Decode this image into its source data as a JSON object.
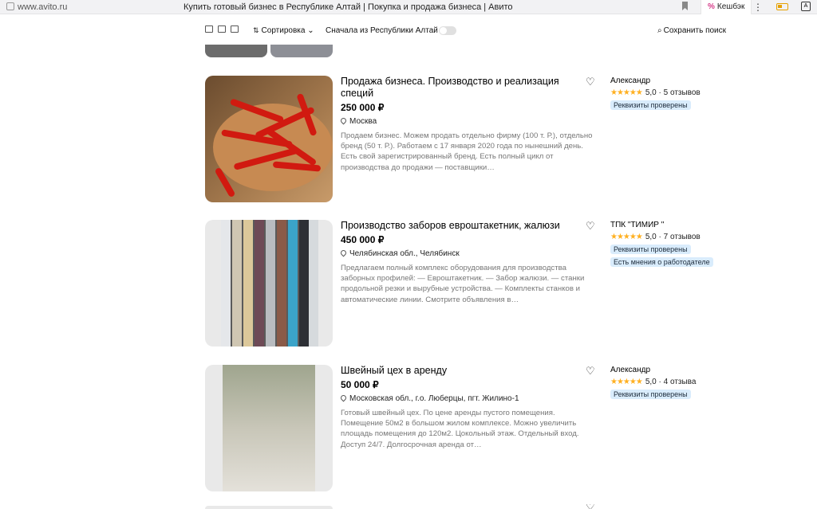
{
  "browser": {
    "url": "www.avito.ru",
    "title": "Купить готовый бизнес в Республике Алтай | Покупка и продажа бизнеса | Авито",
    "cashback": "Кешбэк",
    "cashback_icon": "%"
  },
  "toolbar": {
    "sort_label": "Сортировка",
    "region_filter": "Сначала из Республики Алтай",
    "region_filter_enabled": false,
    "save_search": "Сохранить поиск"
  },
  "listings": [
    {
      "title": "Продажа бизнеса. Производство и реализация специй",
      "price": "250 000 ₽",
      "location": "Москва",
      "description": "Продаем бизнес. Можем продать отдельно фирму (100 т. Р.), отдельно бренд (50 т. Р.). Работаем с 17 января 2020 года по нынешний день. Есть свой зарегистрированный бренд. Есть полный цикл от производства до продажи — поставщики…",
      "seller": "Александр",
      "rating": "5,0",
      "reviews": "5 отзывов",
      "badges": [
        "Реквизиты проверены"
      ]
    },
    {
      "title": "Производство заборов евроштакетник, жалюзи",
      "price": "450 000 ₽",
      "location": "Челябинская обл., Челябинск",
      "description": "Предлагаем полный комплекс оборудования для производства заборных профилей: — Евроштакетник. — Забор жалюзи. — станки продольной резки и вырубные устройства. — Комплекты станков и автоматические линии. Смотрите объявления в…",
      "seller": "ТПК \"ТИМИР \"",
      "rating": "5,0",
      "reviews": "7 отзывов",
      "badges": [
        "Реквизиты проверены",
        "Есть мнения о работодателе"
      ]
    },
    {
      "title": "Швейный цех в аренду",
      "price": "50 000 ₽",
      "location": "Московская обл., г.о. Люберцы, пгт. Жилино-1",
      "description": "Готовый швейный цех. По цене аренды пустого помещения. Помещение 50м2 в большом жилом комплексе. Можно увеличить площадь помещения до 120м2. Цокольный этаж. Отдельный вход. Доступ 24/7. Долгосрочная аренда от…",
      "seller": "Александр",
      "rating": "5,0",
      "reviews": "4 отзыва",
      "badges": [
        "Реквизиты проверены"
      ]
    }
  ],
  "stars": "★★★★★",
  "rating_separator": "·"
}
